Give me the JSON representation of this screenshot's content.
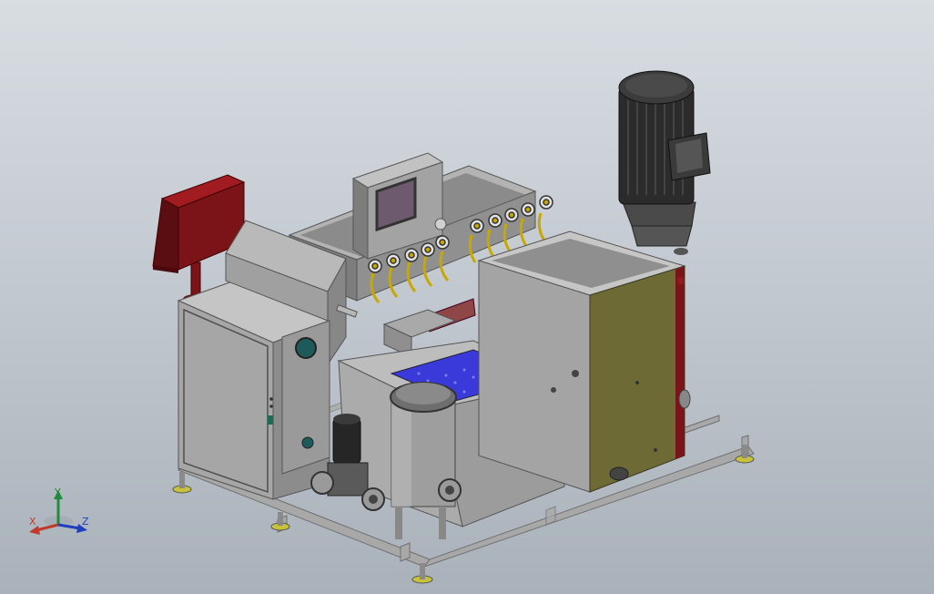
{
  "viewport": {
    "background_top": "#d8dde2",
    "background_bottom": "#a9b1ba"
  },
  "colors": {
    "steel": "#8d8d8d",
    "steel_light": "#b5b5b5",
    "steel_dark": "#5e5e5e",
    "frame": "#a8a8a8",
    "red_panel": "#7a1418",
    "motor": "#2b2b2b",
    "yellow_panel": "#6e6a36",
    "brass": "#c8a800",
    "blue_mesh": "#3a3adb",
    "teal_port": "#1f5a5a"
  },
  "triad": {
    "x_label": "X",
    "y_label": "Y",
    "z_label": "Z",
    "x_color": "#c0392b",
    "y_color": "#1e8c3a",
    "z_color": "#1f3fbf"
  }
}
